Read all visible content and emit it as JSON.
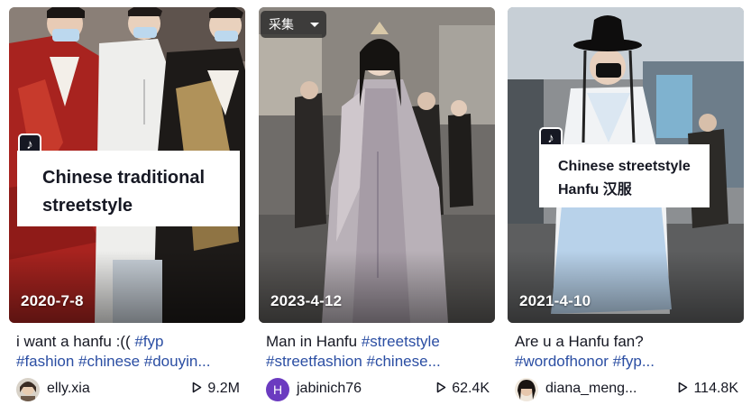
{
  "cards": [
    {
      "date": "2020-7-8",
      "title_lines": [
        "Chinese traditional",
        "streetstyle"
      ],
      "desc_line1_text": "i want a hanfu :(( ",
      "desc_line1_tag": "#fyp",
      "desc_line2_tags": "#fashion #chinese #douyin...",
      "username": "elly.xia",
      "plays": "9.2M"
    },
    {
      "date": "2023-4-12",
      "collect_label": "采集",
      "desc_line1_text": "Man in Hanfu ",
      "desc_line1_tag": "#streetstyle",
      "desc_line2_tags": "#streetfashion #chinese...",
      "avatar_letter": "H",
      "username": "jabinich76",
      "plays": "62.4K"
    },
    {
      "date": "2021-4-10",
      "title_lines": [
        "Chinese streetstyle",
        "Hanfu 汉服"
      ],
      "desc_line1_text": "Are u a Hanfu fan?",
      "desc_line2_tags": "#wordofhonor #fyp...",
      "username": "diana_meng...",
      "plays": "114.8K"
    }
  ],
  "icons": {
    "tiktok_badge": "tiktok-note-icon",
    "play": "play-outline-icon",
    "caret": "caret-down-icon"
  },
  "colors": {
    "hashtag": "#2b4ea3",
    "text": "#161823",
    "avatar_purple": "#6b3bc0"
  }
}
